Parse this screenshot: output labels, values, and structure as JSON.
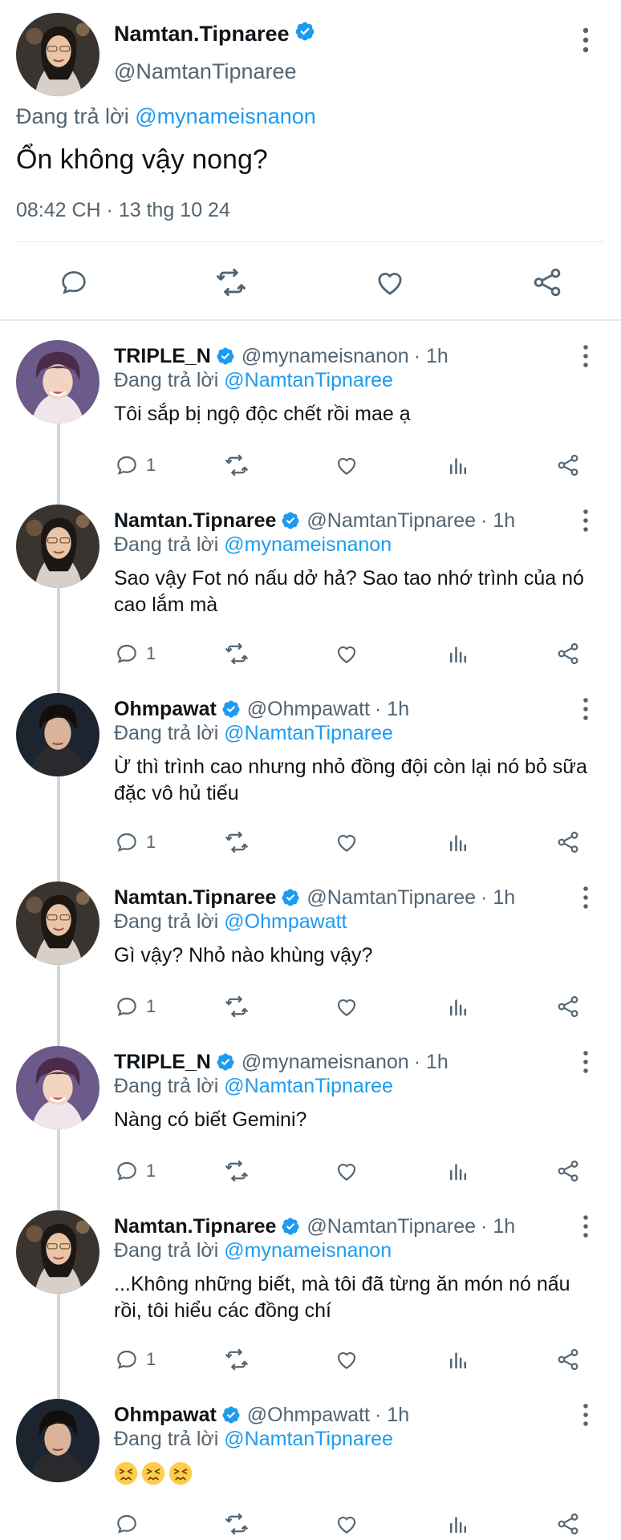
{
  "main_tweet": {
    "name": "Namtan.Tipnaree",
    "handle": "@NamtanTipnaree",
    "replying_prefix": "Đang trả lời",
    "replying_to": "@mynameisnanon",
    "text": "Ổn không vậy nong?",
    "timestamp": "08:42 CH · 13 thg 10 24"
  },
  "replies": [
    {
      "name": "TRIPLE_N",
      "handle": "@mynameisnanon",
      "time": "· 1h",
      "replying_prefix": "Đang trả lời",
      "replying_to": "@NamtanTipnaree",
      "text": "Tôi sắp bị ngộ độc chết rồi mae ạ",
      "reply_count": "1"
    },
    {
      "name": "Namtan.Tipnaree",
      "handle": "@NamtanTipnaree",
      "time": "· 1h",
      "replying_prefix": "Đang trả lời",
      "replying_to": "@mynameisnanon",
      "text": "Sao vậy Fot nó nấu dở hả? Sao tao nhớ trình của nó cao lắm mà",
      "reply_count": "1"
    },
    {
      "name": "Ohmpawat",
      "handle": "@Ohmpawatt",
      "time": "· 1h",
      "replying_prefix": "Đang trả lời",
      "replying_to": "@NamtanTipnaree",
      "text": "Ừ thì trình cao nhưng nhỏ đồng đội còn lại nó bỏ sữa đặc vô hủ tiếu",
      "reply_count": "1"
    },
    {
      "name": "Namtan.Tipnaree",
      "handle": "@NamtanTipnaree",
      "time": "· 1h",
      "replying_prefix": "Đang trả lời",
      "replying_to": "@Ohmpawatt",
      "text": "Gì vậy? Nhỏ nào khùng vậy?",
      "reply_count": "1"
    },
    {
      "name": "TRIPLE_N",
      "handle": "@mynameisnanon",
      "time": "· 1h",
      "replying_prefix": "Đang trả lời",
      "replying_to": "@NamtanTipnaree",
      "text": "Nàng có biết Gemini?",
      "reply_count": "1"
    },
    {
      "name": "Namtan.Tipnaree",
      "handle": "@NamtanTipnaree",
      "time": "· 1h",
      "replying_prefix": "Đang trả lời",
      "replying_to": "@mynameisnanon",
      "text": "...Không những biết, mà tôi đã từng ăn món nó nấu rồi, tôi hiểu các đồng chí",
      "reply_count": "1"
    },
    {
      "name": "Ohmpawat",
      "handle": "@Ohmpawatt",
      "time": "· 1h",
      "replying_prefix": "Đang trả lời",
      "replying_to": "@NamtanTipnaree",
      "emoji": [
        "confounded-face",
        "confounded-face",
        "confounded-face"
      ],
      "reply_count": ""
    }
  ],
  "colors": {
    "accent": "#1d9bf0",
    "text_primary": "#0f1419",
    "text_secondary": "#536471",
    "divider": "#e6e9eb",
    "thread_line": "#cfd9de"
  },
  "icons": {
    "verified": "verified-badge-icon",
    "more": "more-vertical-icon",
    "reply": "reply-icon",
    "retweet": "retweet-icon",
    "like": "like-icon",
    "analytics": "analytics-icon",
    "share": "share-icon"
  }
}
